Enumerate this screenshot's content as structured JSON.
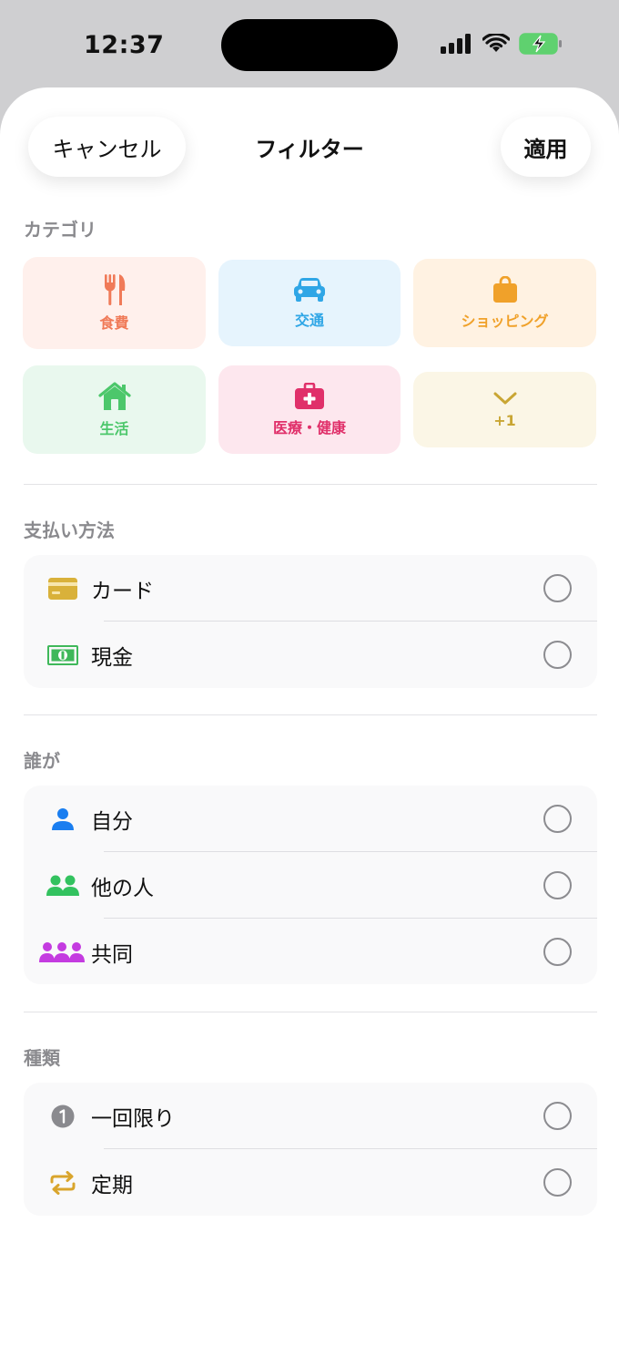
{
  "status_bar": {
    "time": "12:37"
  },
  "header": {
    "cancel_label": "キャンセル",
    "title": "フィルター",
    "apply_label": "適用"
  },
  "category": {
    "title": "カテゴリ",
    "items": [
      {
        "label": "食費",
        "icon": "fork-knife-icon",
        "color": "#f07a58",
        "bg": "#fff0ec"
      },
      {
        "label": "交通",
        "icon": "car-icon",
        "color": "#2fa6e6",
        "bg": "#e6f4fd"
      },
      {
        "label": "ショッピング",
        "icon": "shopping-bag-icon",
        "color": "#f0a12a",
        "bg": "#fff2e2"
      },
      {
        "label": "生活",
        "icon": "house-icon",
        "color": "#4cc76b",
        "bg": "#e9f8ee"
      },
      {
        "label": "医療・健康",
        "icon": "medical-kit-icon",
        "color": "#e0306a",
        "bg": "#fde7ee"
      },
      {
        "label": "+1",
        "icon": "chevron-down-icon",
        "color": "#c9a634",
        "bg": "#fbf6e6"
      }
    ]
  },
  "payment": {
    "title": "支払い方法",
    "items": [
      {
        "label": "カード",
        "icon": "credit-card-icon",
        "color": "#d9b13a"
      },
      {
        "label": "現金",
        "icon": "banknote-icon",
        "color": "#3fb85a"
      }
    ]
  },
  "who": {
    "title": "誰が",
    "items": [
      {
        "label": "自分",
        "icon": "person-icon",
        "color": "#1a7ef0"
      },
      {
        "label": "他の人",
        "icon": "two-people-icon",
        "color": "#33c25f"
      },
      {
        "label": "共同",
        "icon": "three-people-icon",
        "color": "#c43be0"
      }
    ]
  },
  "kind": {
    "title": "種類",
    "items": [
      {
        "label": "一回限り",
        "icon": "number-one-circle-icon",
        "color": "#8a8a8e"
      },
      {
        "label": "定期",
        "icon": "repeat-icon",
        "color": "#d9a52c"
      }
    ]
  }
}
